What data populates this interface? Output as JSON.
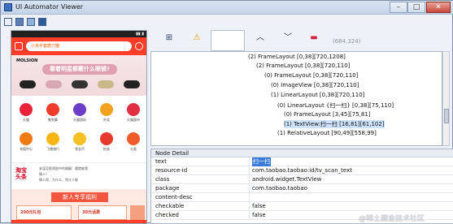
{
  "window": {
    "title": "UI Automator Viewer",
    "controls": [
      "–",
      "□",
      "✕"
    ]
  },
  "device": {
    "search_placeholder": "小米手套磨刀猫",
    "brand": "MOLSION",
    "slogan": "看着明星都戴什么眼镜?",
    "icons": [
      {
        "label": "天猫",
        "color": "#e8233a"
      },
      {
        "label": "聚划算",
        "color": "#ef3d2b"
      },
      {
        "label": "天猫国际",
        "color": "#6b3dc8"
      },
      {
        "label": "外卖",
        "color": "#f2a21f"
      },
      {
        "label": "天猫超市",
        "color": "#e02f43"
      },
      {
        "label": "充值中心",
        "color": "#f07b14"
      },
      {
        "label": "飞猪旅行",
        "color": "#f7b615"
      },
      {
        "label": "领金币",
        "color": "#f6c223"
      },
      {
        "label": "拍卖",
        "color": "#e63a2e"
      },
      {
        "label": "分类",
        "color": "#f05b2b"
      }
    ],
    "news_logo_1": "淘宝",
    "news_logo_2": "头条",
    "news_line_1": "安谋至影视剧中的婚姻：遇就被我",
    "news_line_2": "情人！",
    "news_line_3": "情人保，为什么，然大人能",
    "promo_title": "新人专享福利",
    "card_1": "200元礼包",
    "card_2": "30元话费"
  },
  "toolbar": {
    "coords": "(684,324)"
  },
  "tree": [
    "(2) FrameLayout [0,38][720,1208]",
    "(2) FrameLayout [0,38][720,110]",
    "(0) FrameLayout [0,38][720,110]",
    "(0) ImageView [0,38][720,110]",
    "(1) LinearLayout [0,38][720,110]",
    "(0) LinearLayout {扫一扫} [0,38][75,110]",
    "(0) FrameLayout [3,45][75,81]",
    "(1) TextView:扫一扫 [16,81][61,102]",
    "(1) RelativeLayout [90,49][558,99]"
  ],
  "detail": {
    "header": "Node Detail",
    "rows": [
      {
        "key": "text",
        "value": "扫一扫"
      },
      {
        "key": "resource-id",
        "value": "com.taobao.taobao:id/tv_scan_text"
      },
      {
        "key": "class",
        "value": "android.widget.TextView"
      },
      {
        "key": "package",
        "value": "com.taobao.taobao"
      },
      {
        "key": "content-desc",
        "value": ""
      },
      {
        "key": "checkable",
        "value": "false"
      },
      {
        "key": "checked",
        "value": "false"
      }
    ]
  },
  "watermark": "@稀土掘金技术社区"
}
